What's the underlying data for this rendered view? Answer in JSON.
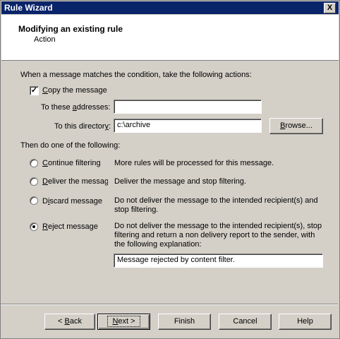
{
  "window": {
    "title": "Rule Wizard",
    "close_label": "X"
  },
  "header": {
    "title": "Modifying an existing rule",
    "subtitle": "Action"
  },
  "intro": "When a message matches the condition, take the following actions:",
  "copy": {
    "checked": true,
    "check_mark": "✓",
    "label_pre": "",
    "label_ul": "C",
    "label_post": "opy the message"
  },
  "addresses": {
    "label_pre": "To these ",
    "label_ul": "a",
    "label_post": "ddresses:",
    "value": ""
  },
  "directory": {
    "label_pre": "To this director",
    "label_ul": "y",
    "label_post": ":",
    "value": "c:\\archive",
    "browse_ul": "B",
    "browse_post": "rowse..."
  },
  "then_label": "Then do one of the following:",
  "options": [
    {
      "ul": "C",
      "rest": "ontinue filtering",
      "desc": "More rules will be processed for this message.",
      "selected": false
    },
    {
      "ul": "D",
      "rest": "eliver the message",
      "desc": "Deliver the message and stop filtering.",
      "selected": false
    },
    {
      "ul": "",
      "rest_pre": "D",
      "ul2": "i",
      "rest": "scard message",
      "desc": "Do not deliver the message to the intended recipient(s) and stop filtering.",
      "selected": false
    },
    {
      "ul": "R",
      "rest": "eject message",
      "desc": "Do not deliver the message to the intended recipient(s), stop filtering and return a non delivery report to the sender, with the following explanation:",
      "selected": true
    }
  ],
  "reject_text": "Message rejected by content filter.",
  "buttons": {
    "back": {
      "pre": "< ",
      "ul": "B",
      "post": "ack"
    },
    "next": {
      "ul": "N",
      "post": "ext >"
    },
    "finish": "Finish",
    "cancel": "Cancel",
    "help": "Help"
  }
}
